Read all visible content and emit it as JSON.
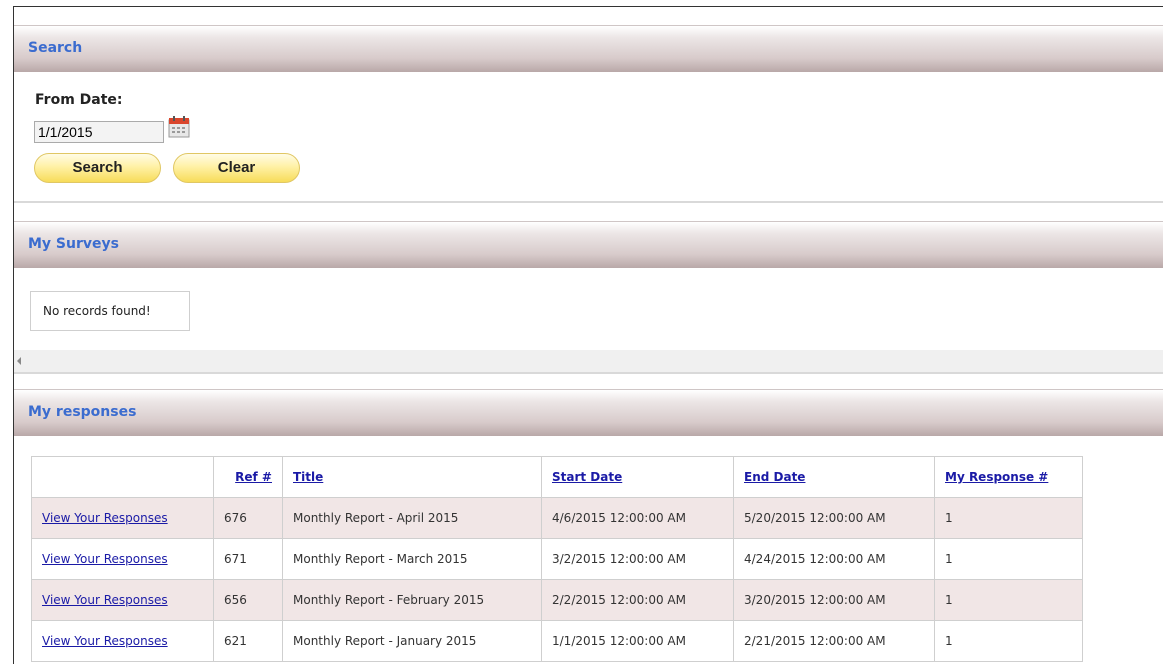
{
  "sections": {
    "search": {
      "title": "Search"
    },
    "surveys": {
      "title": "My Surveys",
      "empty_text": "No records found!"
    },
    "responses": {
      "title": "My responses"
    }
  },
  "search_form": {
    "from_date_label": "From Date:",
    "from_date_value": "1/1/2015",
    "search_button": "Search",
    "clear_button": "Clear",
    "calendar_icon": "calendar-icon"
  },
  "responses_table": {
    "headers": [
      "",
      "Ref #",
      "Title",
      "Start Date",
      "End Date",
      "My Response #"
    ],
    "rows": [
      {
        "action": "View Your Responses",
        "ref": "676",
        "title": "Monthly Report - April 2015",
        "start": "4/6/2015 12:00:00 AM",
        "end": "5/20/2015 12:00:00 AM",
        "response": "1"
      },
      {
        "action": "View Your Responses",
        "ref": "671",
        "title": "Monthly Report - March 2015",
        "start": "3/2/2015 12:00:00 AM",
        "end": "4/24/2015 12:00:00 AM",
        "response": "1"
      },
      {
        "action": "View Your Responses",
        "ref": "656",
        "title": "Monthly Report - February 2015",
        "start": "2/2/2015 12:00:00 AM",
        "end": "3/20/2015 12:00:00 AM",
        "response": "1"
      },
      {
        "action": "View Your Responses",
        "ref": "621",
        "title": "Monthly Report - January 2015",
        "start": "1/1/2015 12:00:00 AM",
        "end": "2/21/2015 12:00:00 AM",
        "response": "1"
      }
    ]
  },
  "colors": {
    "section_title": "#3b6ccf",
    "link": "#1a1aa6",
    "alt_row": "#f1e6e6",
    "button_fill": "#fff1a6"
  }
}
